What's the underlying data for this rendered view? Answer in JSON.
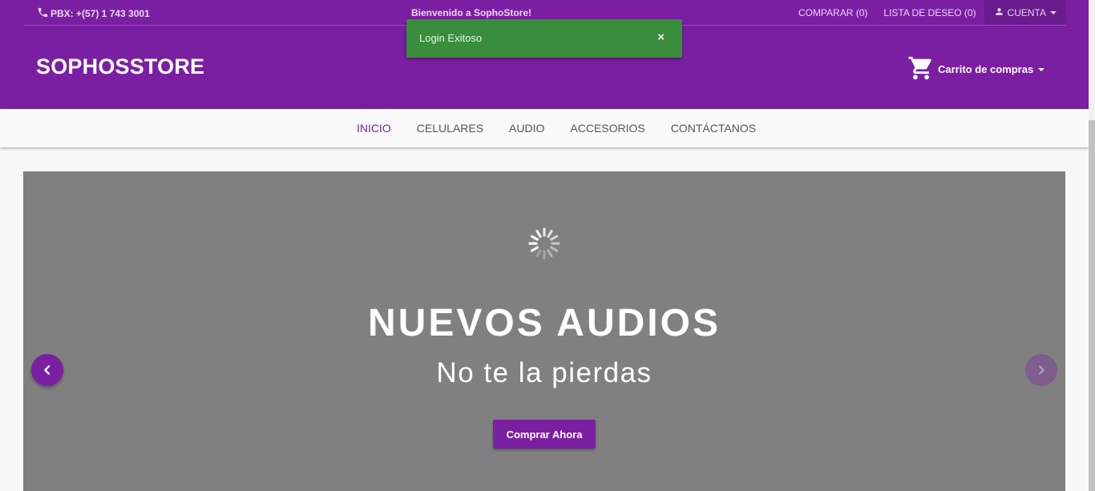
{
  "topbar": {
    "phone": "PBX: +(57) 1 743 3001",
    "welcome": "Bienvenido a SophoStore!",
    "compare": "COMPARAR (0)",
    "wishlist": "LISTA DE DESEO (0)",
    "account": "CUENTA"
  },
  "header": {
    "brand": "SOPHOSSTORE",
    "cart_label": "Carrito de compras"
  },
  "toast": {
    "message": "Login Exitoso",
    "close": "×"
  },
  "nav": {
    "items": [
      {
        "label": "INICIO",
        "active": true
      },
      {
        "label": "CELULARES"
      },
      {
        "label": "AUDIO"
      },
      {
        "label": "ACCESORIOS"
      },
      {
        "label": "CONTÁCTANOS"
      }
    ]
  },
  "hero": {
    "title": "NUEVOS AUDIOS",
    "subtitle": "No te la pierdas",
    "button": "Comprar Ahora"
  },
  "icons": {
    "phone": "phone-icon",
    "account": "person-icon",
    "cart": "shopping-cart-icon",
    "spinner": "loading-spinner-icon",
    "prev": "chevron-left-icon",
    "next": "chevron-right-icon"
  },
  "colors": {
    "primary": "#7b1fa2",
    "toast": "#388e3c",
    "hero_bg": "#808080"
  }
}
